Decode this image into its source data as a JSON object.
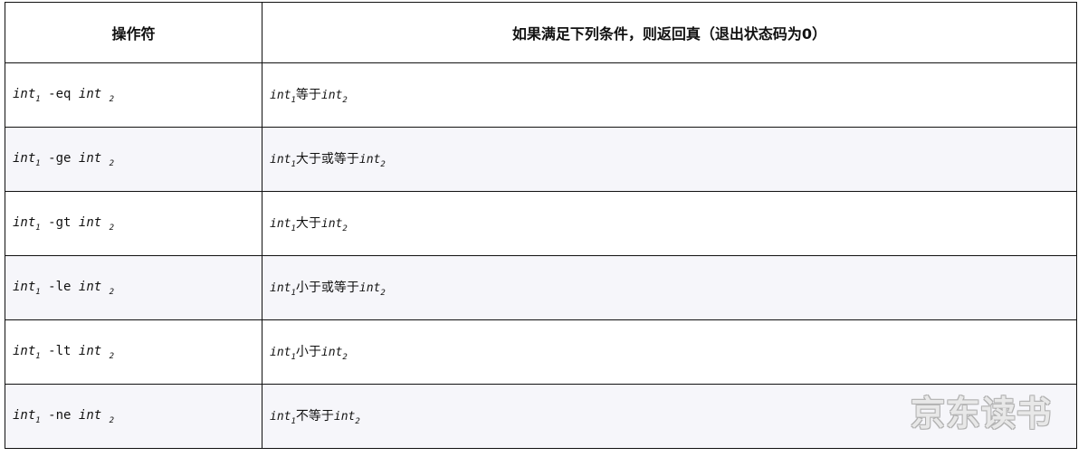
{
  "table": {
    "headers": {
      "operator": "操作符",
      "condition": "如果满足下列条件，则返回真（退出状态码为0）"
    },
    "rows": [
      {
        "var1": "int",
        "sub1": "1",
        "op": "-eq",
        "var2": "int",
        "sub2": "2",
        "d_var1": "int",
        "d_sub1": "1",
        "d_text": "等于",
        "d_var2": "int",
        "d_sub2": "2"
      },
      {
        "var1": "int",
        "sub1": "1",
        "op": "-ge",
        "var2": "int",
        "sub2": "2",
        "d_var1": "int",
        "d_sub1": "1",
        "d_text": "大于或等于",
        "d_var2": "int",
        "d_sub2": "2"
      },
      {
        "var1": "int",
        "sub1": "1",
        "op": "-gt",
        "var2": "int",
        "sub2": "2",
        "d_var1": "int",
        "d_sub1": "1",
        "d_text": "大于",
        "d_var2": "int",
        "d_sub2": "2"
      },
      {
        "var1": "int",
        "sub1": "1",
        "op": "-le",
        "var2": "int",
        "sub2": "2",
        "d_var1": "int",
        "d_sub1": "1",
        "d_text": "小于或等于",
        "d_var2": "int",
        "d_sub2": "2"
      },
      {
        "var1": "int",
        "sub1": "1",
        "op": "-lt",
        "var2": "int",
        "sub2": "2",
        "d_var1": "int",
        "d_sub1": "1",
        "d_text": "小于",
        "d_var2": "int",
        "d_sub2": "2"
      },
      {
        "var1": "int",
        "sub1": "1",
        "op": "-ne",
        "var2": "int",
        "sub2": "2",
        "d_var1": "int",
        "d_sub1": "1",
        "d_text": "不等于",
        "d_var2": "int",
        "d_sub2": "2"
      }
    ]
  },
  "watermark": "京东读书"
}
